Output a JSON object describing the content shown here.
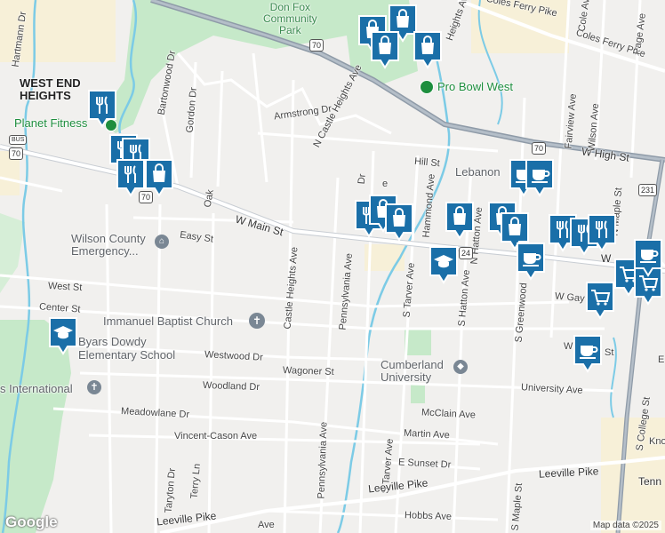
{
  "map": {
    "areas": {
      "west_end_heights": "WEST END\nHEIGHTS",
      "don_fox_park": "Don Fox\nCommunity\nPark"
    },
    "places": {
      "planet_fitness": "Planet Fitness",
      "pro_bowl_west": "Pro Bowl West",
      "wilson_county": "Wilson County\nEmergency...",
      "immanuel_baptist": "Immanuel Baptist Church",
      "byars_dowdy": "Byars Dowdy\nElementary School",
      "cumberland_university": "Cumberland\nUniversity",
      "lebanon": "Lebanon",
      "international": "s International"
    },
    "streets": {
      "hartmann": "Hartmann Dr",
      "bartonwood": "Bartonwood Dr",
      "gordon": "Gordon Dr",
      "armstrong": "Armstrong Dr",
      "n_castle_heights": "N Castle Heights Ave",
      "heights_ave": "Heights Ave",
      "coles_ferry": "Coles Ferry Pike",
      "coles_ferry2": "Coles Ferry Pike",
      "cole_ave": "Cole Ave",
      "page_ave": "Page Ave",
      "hill_st": "Hill St",
      "w_high_st": "W High St",
      "fairview": "Fairview Ave",
      "wilson_ave": "Wilson Ave",
      "n_maple": "N Maple St",
      "w_main": "W Main St",
      "oak": "Oak",
      "easy_st": "Easy St",
      "castle_heights_ave": "Castle Heights Ave",
      "pennsylvania_ave": "Pennsylvania Ave",
      "pennsylvania_ave2": "Pennsylvania Ave",
      "hammond": "Hammond Ave",
      "n_hatton": "N Hatton Ave",
      "s_tarver": "S Tarver Ave",
      "s_tarver2": "S Tarver Ave",
      "s_hatton": "S Hatton Ave",
      "s_greenwood": "S Greenwood",
      "w_gay": "W Gay",
      "west_st": "West St",
      "center_st": "Center St",
      "westwood": "Westwood Dr",
      "wagoner": "Wagoner St",
      "woodland": "Woodland Dr",
      "meadowlane": "Meadowlane Dr",
      "mcclain": "McClain Ave",
      "vincent_cason": "Vincent-Cason Ave",
      "martin": "Martin Ave",
      "e_sunset": "E Sunset Dr",
      "university_ave": "University Ave",
      "leeville_pike": "Leeville Pike",
      "leeville_pike2": "Leeville Pike",
      "leeville_pike3": "Leeville Pike",
      "hobbs": "Hobbs Ave",
      "taryton": "Taryton Dr",
      "terry": "Terry Ln",
      "s_maple": "S Maple St",
      "s_college": "S College St",
      "tenn": "Tenn",
      "kno": "Kno",
      "ave_bottom": "Ave",
      "w_st": "W",
      "st_right": "St",
      "e_right": "E",
      "dr_top": "Dr",
      "e_top": "e",
      "w_main_right": "W"
    },
    "shields": {
      "us70_a": "70",
      "us70_b": "70",
      "us70_c": "70",
      "us70_bus": "BUS",
      "us70_bus_num": "70",
      "us231": "231",
      "r24": "24"
    },
    "attribution": "Map data ©2025",
    "logo": "Google"
  },
  "colors": {
    "pin": "#1a6fa8",
    "road_major": "#8a9aa8",
    "water": "#6cc4e2",
    "park": "#c2e8c8"
  },
  "pins": [
    {
      "icon": "restaurant-icon"
    },
    {
      "icon": "restaurant-icon"
    },
    {
      "icon": "restaurant-icon"
    },
    {
      "icon": "restaurant-icon"
    },
    {
      "icon": "shopping-bag-icon"
    },
    {
      "icon": "shopping-bag-icon"
    },
    {
      "icon": "shopping-bag-icon"
    },
    {
      "icon": "shopping-bag-icon"
    },
    {
      "icon": "shopping-bag-icon"
    },
    {
      "icon": "restaurant-icon"
    },
    {
      "icon": "shopping-bag-icon"
    },
    {
      "icon": "shopping-bag-icon"
    },
    {
      "icon": "graduation-cap-icon"
    },
    {
      "icon": "shopping-bag-icon"
    },
    {
      "icon": "shopping-bag-icon"
    },
    {
      "icon": "shopping-bag-icon"
    },
    {
      "icon": "coffee-cup-icon"
    },
    {
      "icon": "coffee-cup-icon"
    },
    {
      "icon": "restaurant-icon"
    },
    {
      "icon": "restaurant-icon"
    },
    {
      "icon": "restaurant-icon"
    },
    {
      "icon": "coffee-cup-icon"
    },
    {
      "icon": "shopping-cart-icon"
    },
    {
      "icon": "shopping-cart-icon"
    },
    {
      "icon": "shopping-cart-icon"
    },
    {
      "icon": "coffee-cup-icon"
    },
    {
      "icon": "graduation-cap-icon"
    },
    {
      "icon": "coffee-cup-icon"
    }
  ]
}
